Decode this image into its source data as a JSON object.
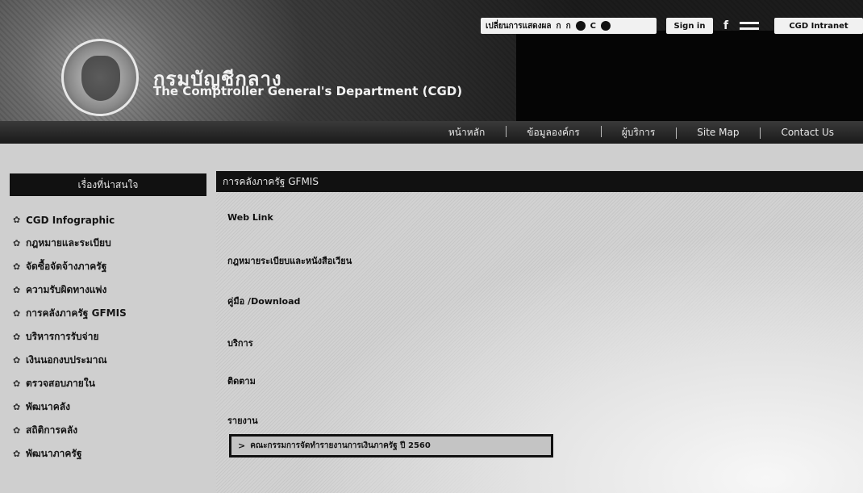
{
  "header": {
    "org_name_thai": "กรมบัญชีกลาง",
    "org_name_eng": "The Comptroller General's Department (CGD)",
    "logo_icon": "garuda-emblem-icon",
    "language_box": {
      "label": "เปลี่ยนการแสดงผล",
      "options": [
        "ก",
        "ก",
        "C"
      ]
    },
    "signin_label": "Sign in",
    "facebook_label": "f",
    "intranet_label": "CGD Intranet"
  },
  "nav": {
    "items": [
      "หน้าหลัก",
      "ข้อมูลองค์กร",
      "ผู้บริการ",
      "Site Map",
      "Contact Us"
    ]
  },
  "sidebar": {
    "title": "เรื่องที่น่าสนใจ",
    "items": [
      "CGD Infographic",
      "กฎหมายและระเบียบ",
      "จัดซื้อจัดจ้างภาครัฐ",
      "ความรับผิดทางแพ่ง",
      "การคลังภาครัฐ GFMIS",
      "บริหารการรับจ่าย",
      "เงินนอกงบประมาณ",
      "ตรวจสอบภายใน",
      "พัฒนาคลัง",
      "สถิติการคลัง",
      "พัฒนาภาครัฐ"
    ]
  },
  "main": {
    "title": "การคลังภาครัฐ GFMIS",
    "links": [
      "Web Link",
      "กฎหมายระเบียบและหนังสือเวียน",
      "คู่มือ /Download",
      "บริการ",
      "ติดตาม",
      "รายงาน"
    ],
    "highlighted_link": "คณะกรรมการจัดทำรายงานการเงินภาครัฐ ปี 2560"
  }
}
